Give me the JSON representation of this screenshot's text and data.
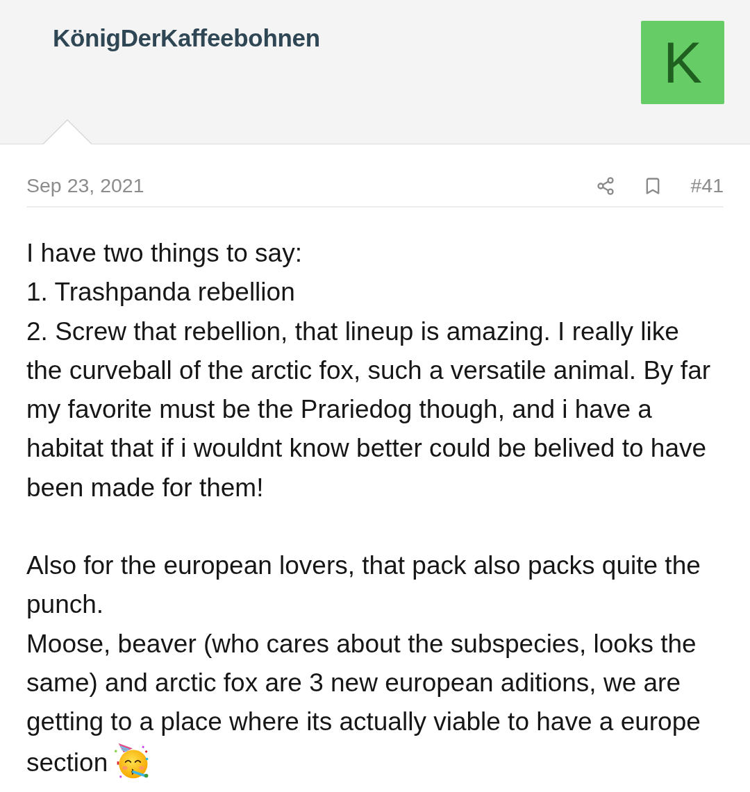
{
  "post": {
    "author": {
      "name": "KönigDerKaffeebohnen",
      "avatar_letter": "K"
    },
    "meta": {
      "date": "Sep 23, 2021",
      "number": "#41"
    },
    "body": {
      "paragraphs": [
        {
          "lines": [
            {
              "kind": "plain",
              "text": "I have two things to say:"
            },
            {
              "kind": "plain",
              "text": "1. Trashpanda rebellion"
            },
            {
              "kind": "plain",
              "text": "2. Screw that rebellion, that lineup is amazing. I really like the curveball of the arctic fox, such a versatile animal. By far my favorite must be the Prariedog though, and i have a habitat that if i wouldnt know better could be belived to have been made for them!"
            }
          ]
        },
        {
          "lines": [
            {
              "kind": "plain",
              "text": "Also for the european lovers, that pack also packs quite the punch."
            },
            {
              "kind": "with-emoji",
              "text": "Moose, beaver (who cares about the subspecies, looks the same) and arctic fox are 3 new european aditions, we are getting to a place where its actually viable to have a europe section"
            }
          ]
        }
      ]
    }
  }
}
